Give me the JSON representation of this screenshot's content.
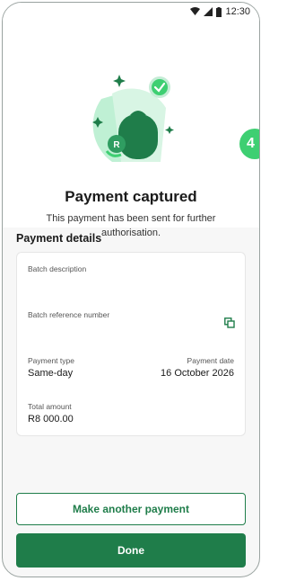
{
  "status_bar": {
    "time": "12:30",
    "icons": [
      "wifi-icon",
      "signal-icon",
      "battery-icon"
    ]
  },
  "side_badge": {
    "label": "4"
  },
  "header": {
    "title": "Payment captured",
    "subtitle": "This payment has been sent for further authorisation."
  },
  "details": {
    "heading": "Payment details",
    "batch_description_label": "Batch description",
    "batch_description_value": "",
    "batch_reference_label": "Batch reference number",
    "batch_reference_value": "",
    "payment_type_label": "Payment type",
    "payment_type_value": "Same-day",
    "payment_date_label": "Payment date",
    "payment_date_value": "16 October 2026",
    "total_amount_label": "Total amount",
    "total_amount_value": "R8 000.00"
  },
  "actions": {
    "another_payment_label": "Make another payment",
    "done_label": "Done"
  },
  "colors": {
    "brand_green": "#1f7d4a",
    "badge_green": "#3ecf72",
    "light_green": "#bff0d4"
  }
}
